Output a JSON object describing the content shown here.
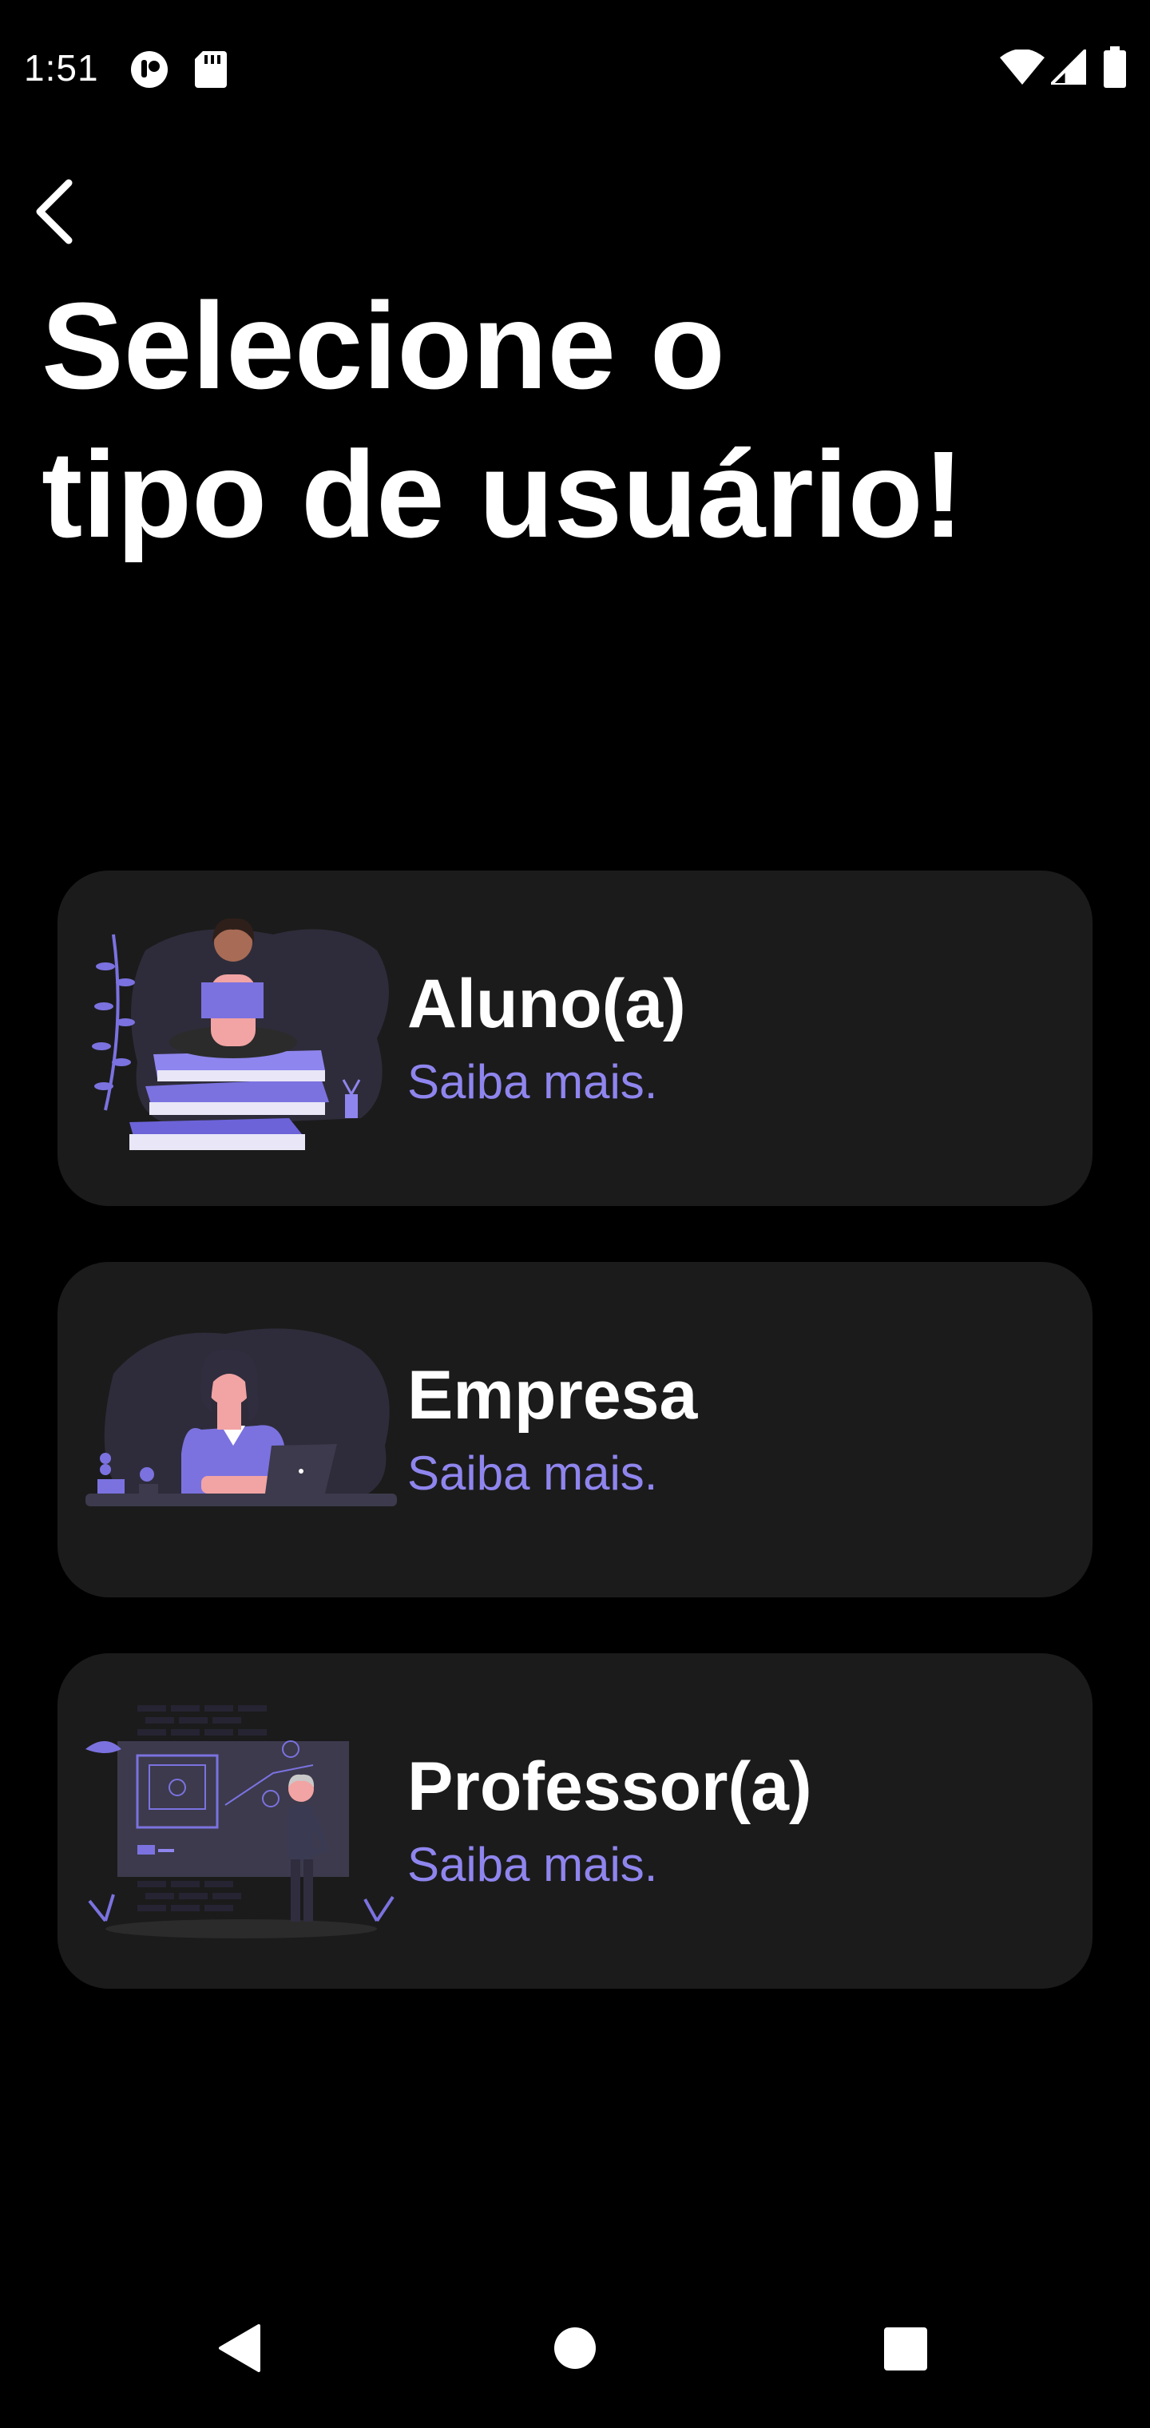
{
  "status_bar": {
    "time": "1:51",
    "left_icons": [
      "notification-icon",
      "sd-card-icon"
    ],
    "right_icons": [
      "wifi-icon",
      "signal-icon",
      "battery-icon"
    ]
  },
  "header": {
    "back_icon": "chevron-left-icon",
    "title_line1": "Selecione o",
    "title_line2": "tipo de usuário!"
  },
  "options": [
    {
      "title": "Aluno(a)",
      "link": "Saiba mais.",
      "illustration": "student-reading-books-illustration"
    },
    {
      "title": "Empresa",
      "link": "Saiba mais.",
      "illustration": "woman-at-desk-laptop-illustration"
    },
    {
      "title": "Professor(a)",
      "link": "Saiba mais.",
      "illustration": "teacher-at-whiteboard-illustration"
    }
  ],
  "nav_bar": {
    "back": "nav-back-icon",
    "home": "nav-home-icon",
    "recents": "nav-recents-icon"
  },
  "colors": {
    "background": "#000000",
    "card": "#1b1b1b",
    "accent": "#8f85ee",
    "text": "#ffffff"
  }
}
